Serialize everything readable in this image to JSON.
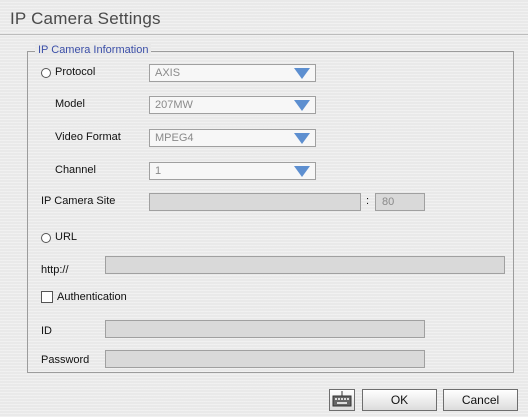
{
  "title": "IP Camera Settings",
  "group": {
    "legend": "IP Camera Information"
  },
  "protocol": {
    "label": "Protocol",
    "value": "AXIS"
  },
  "model": {
    "label": "Model",
    "value": "207MW"
  },
  "video_format": {
    "label": "Video Format",
    "value": "MPEG4"
  },
  "channel": {
    "label": "Channel",
    "value": "1"
  },
  "site": {
    "label": "IP Camera Site",
    "host": "",
    "separator": ":",
    "port": "80"
  },
  "url": {
    "label": "URL",
    "prefix": "http://",
    "value": ""
  },
  "auth": {
    "label": "Authentication"
  },
  "id": {
    "label": "ID",
    "value": ""
  },
  "password": {
    "label": "Password",
    "value": ""
  },
  "buttons": {
    "ok": "OK",
    "cancel": "Cancel",
    "keyboard_icon": "keyboard-icon"
  },
  "colors": {
    "accent": "#5d8fd0",
    "legend": "#3b4fa8"
  }
}
